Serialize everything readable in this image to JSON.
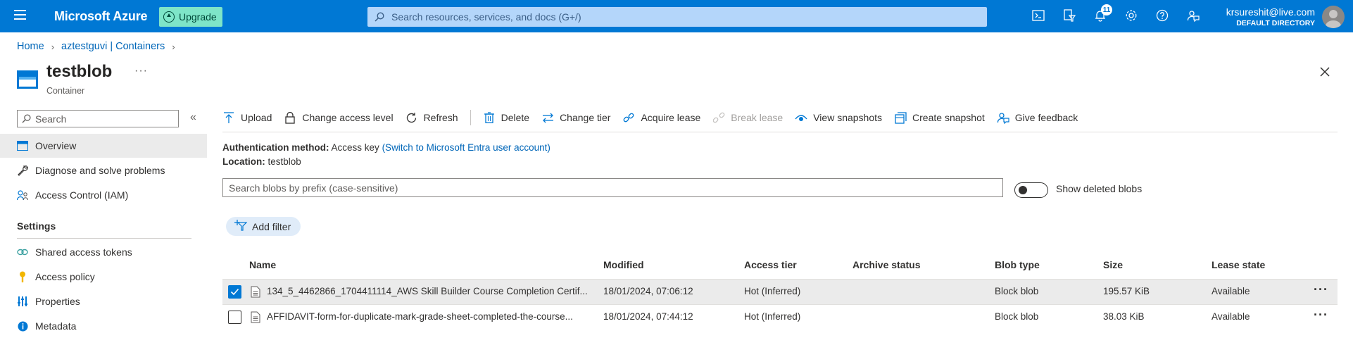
{
  "topbar": {
    "brand": "Microsoft Azure",
    "upgrade_label": "Upgrade",
    "search_placeholder": "Search resources, services, and docs (G+/)",
    "notification_count": "11",
    "account_email": "krsureshit@live.com",
    "account_directory": "DEFAULT DIRECTORY",
    "icons": [
      "cloud-shell-icon",
      "directory-filter-icon",
      "notifications-icon",
      "settings-icon",
      "help-icon",
      "feedback-icon"
    ]
  },
  "breadcrumb": {
    "home": "Home",
    "parent": "aztestguvi | Containers"
  },
  "header": {
    "title": "testblob",
    "more": "···",
    "subtitle": "Container"
  },
  "nav": {
    "search_placeholder": "Search",
    "collapse": "«",
    "items": [
      {
        "label": "Overview",
        "icon": "overview-icon",
        "active": true
      },
      {
        "label": "Diagnose and solve problems",
        "icon": "wrench-icon"
      },
      {
        "label": "Access Control (IAM)",
        "icon": "people-icon"
      }
    ],
    "settings_title": "Settings",
    "settings_items": [
      {
        "label": "Shared access tokens",
        "icon": "link-icon"
      },
      {
        "label": "Access policy",
        "icon": "key-icon"
      },
      {
        "label": "Properties",
        "icon": "properties-icon"
      },
      {
        "label": "Metadata",
        "icon": "info-icon"
      }
    ]
  },
  "toolbar": {
    "upload": "Upload",
    "change_access_level": "Change access level",
    "refresh": "Refresh",
    "delete": "Delete",
    "change_tier": "Change tier",
    "acquire_lease": "Acquire lease",
    "break_lease": "Break lease",
    "view_snapshots": "View snapshots",
    "create_snapshot": "Create snapshot",
    "give_feedback": "Give feedback"
  },
  "info": {
    "auth_label": "Authentication method:",
    "auth_value": "Access key",
    "auth_link": "(Switch to Microsoft Entra user account)",
    "location_label": "Location:",
    "location_value": "testblob"
  },
  "filters": {
    "blob_search_placeholder": "Search blobs by prefix (case-sensitive)",
    "show_deleted_label": "Show deleted blobs",
    "show_deleted": false,
    "add_filter": "Add filter"
  },
  "table": {
    "columns": [
      "Name",
      "Modified",
      "Access tier",
      "Archive status",
      "Blob type",
      "Size",
      "Lease state"
    ],
    "rows": [
      {
        "selected": true,
        "name": "134_5_4462866_1704411114_AWS Skill Builder Course Completion Certif...",
        "modified": "18/01/2024, 07:06:12",
        "access_tier": "Hot (Inferred)",
        "archive_status": "",
        "blob_type": "Block blob",
        "size": "195.57 KiB",
        "lease_state": "Available"
      },
      {
        "selected": false,
        "name": "AFFIDAVIT-form-for-duplicate-mark-grade-sheet-completed-the-course...",
        "modified": "18/01/2024, 07:44:12",
        "access_tier": "Hot (Inferred)",
        "archive_status": "",
        "blob_type": "Block blob",
        "size": "38.03 KiB",
        "lease_state": "Available"
      }
    ],
    "row_menu": "···"
  },
  "colors": {
    "azure_blue": "#0078d4",
    "upgrade_green": "#7ee5c8",
    "search_bg": "#b4d6fa",
    "link": "#0066b8",
    "selected_row": "#ebebeb"
  }
}
